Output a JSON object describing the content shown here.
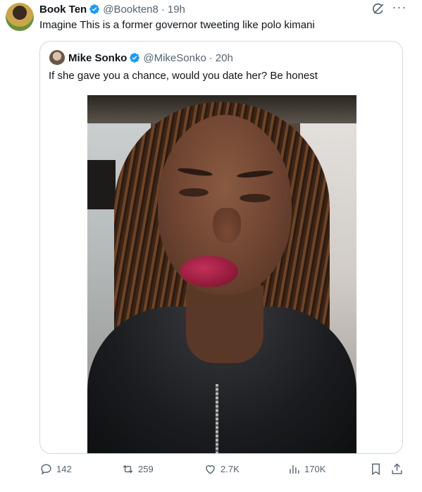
{
  "tweet": {
    "author_name": "Book Ten",
    "author_handle": "@Bookten8",
    "time": "19h",
    "separator": "·",
    "text": "Imagine This is a former governor tweeting like polo kimani"
  },
  "quoted": {
    "author_name": "Mike Sonko",
    "author_handle": "@MikeSonko",
    "time": "20h",
    "separator": "·",
    "text": "If she gave you a chance, would you date her? Be honest"
  },
  "actions": {
    "replies": "142",
    "reposts": "259",
    "likes": "2.7K",
    "views": "170K"
  },
  "icons": {
    "verified": "verified-badge-icon",
    "grok": "grok-icon",
    "more": "more-icon",
    "reply": "reply-icon",
    "repost": "repost-icon",
    "like": "like-icon",
    "views": "views-icon",
    "bookmark": "bookmark-icon",
    "share": "share-icon"
  },
  "colors": {
    "verified": "#1d9bf0",
    "secondary_text": "#536471",
    "primary_text": "#0f1419",
    "border": "#cfd9de"
  }
}
